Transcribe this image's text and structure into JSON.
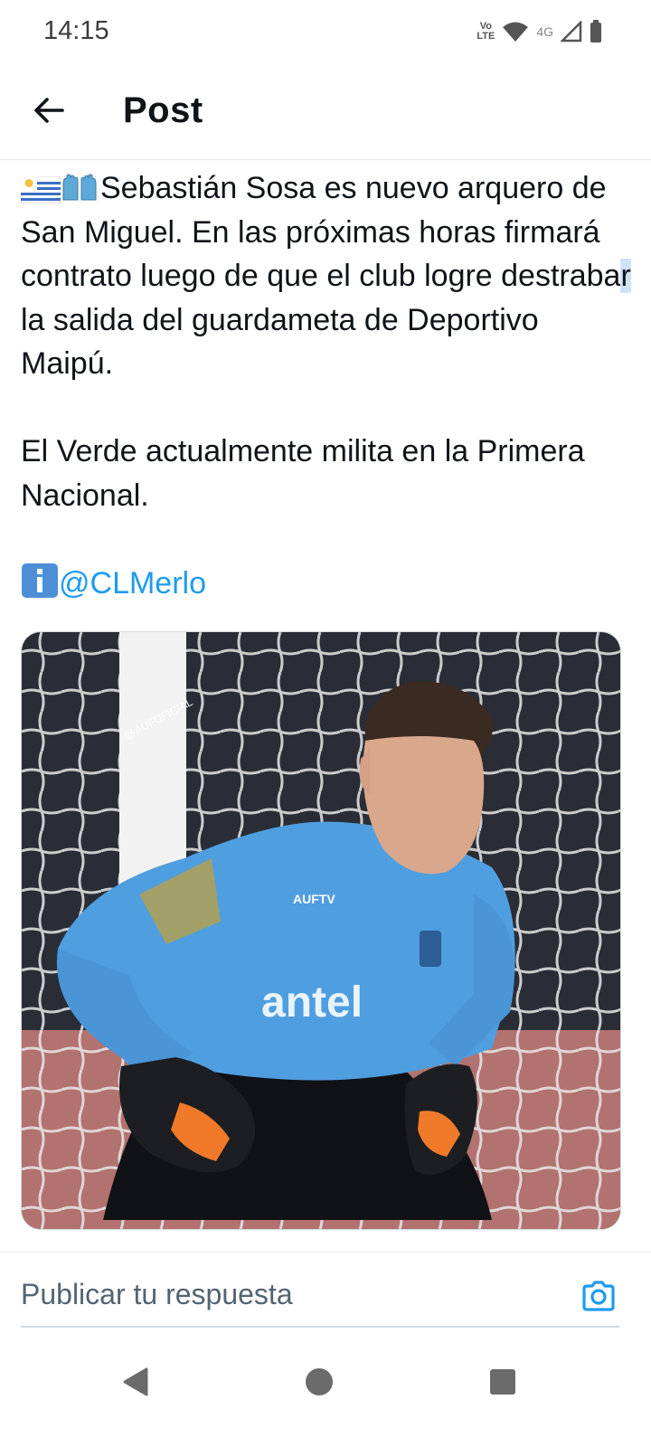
{
  "status_bar": {
    "time": "14:15",
    "volte_top": "Vo",
    "volte_bottom": "LTE",
    "network": "4G"
  },
  "header": {
    "title": "Post",
    "back_icon": "arrow-left-icon"
  },
  "post": {
    "text_line1": "Sebastián Sosa es nuevo arquero de San Miguel. En las próximas horas firmará contrato luego de que el club logre destraba",
    "text_cursor_char": "r",
    "text_line1_end": " la salida del guardameta de Deportivo Maipú.",
    "text_para2": "El Verde actualmente milita en la Primera Nacional.",
    "mention": "@CLMerlo",
    "leading_icons": [
      "uruguay-flag-icon",
      "gloves-icon"
    ],
    "info_icon": "information-icon"
  },
  "media": {
    "watermark": "@AUFOFICIAL",
    "sponsor_text": "antel",
    "badge_text": "AUFTV",
    "colors": {
      "jersey": "#4f9ee0",
      "net_background": "#2a2d36",
      "track": "#b2726f"
    }
  },
  "reply": {
    "placeholder": "Publicar tu respuesta",
    "camera_icon": "camera-icon"
  },
  "nav": {
    "back_icon": "nav-back-icon",
    "home_icon": "nav-home-icon",
    "recents_icon": "nav-recents-icon"
  },
  "colors": {
    "accent": "#1d9bf0",
    "text": "#0f1419",
    "secondary": "#536471"
  }
}
